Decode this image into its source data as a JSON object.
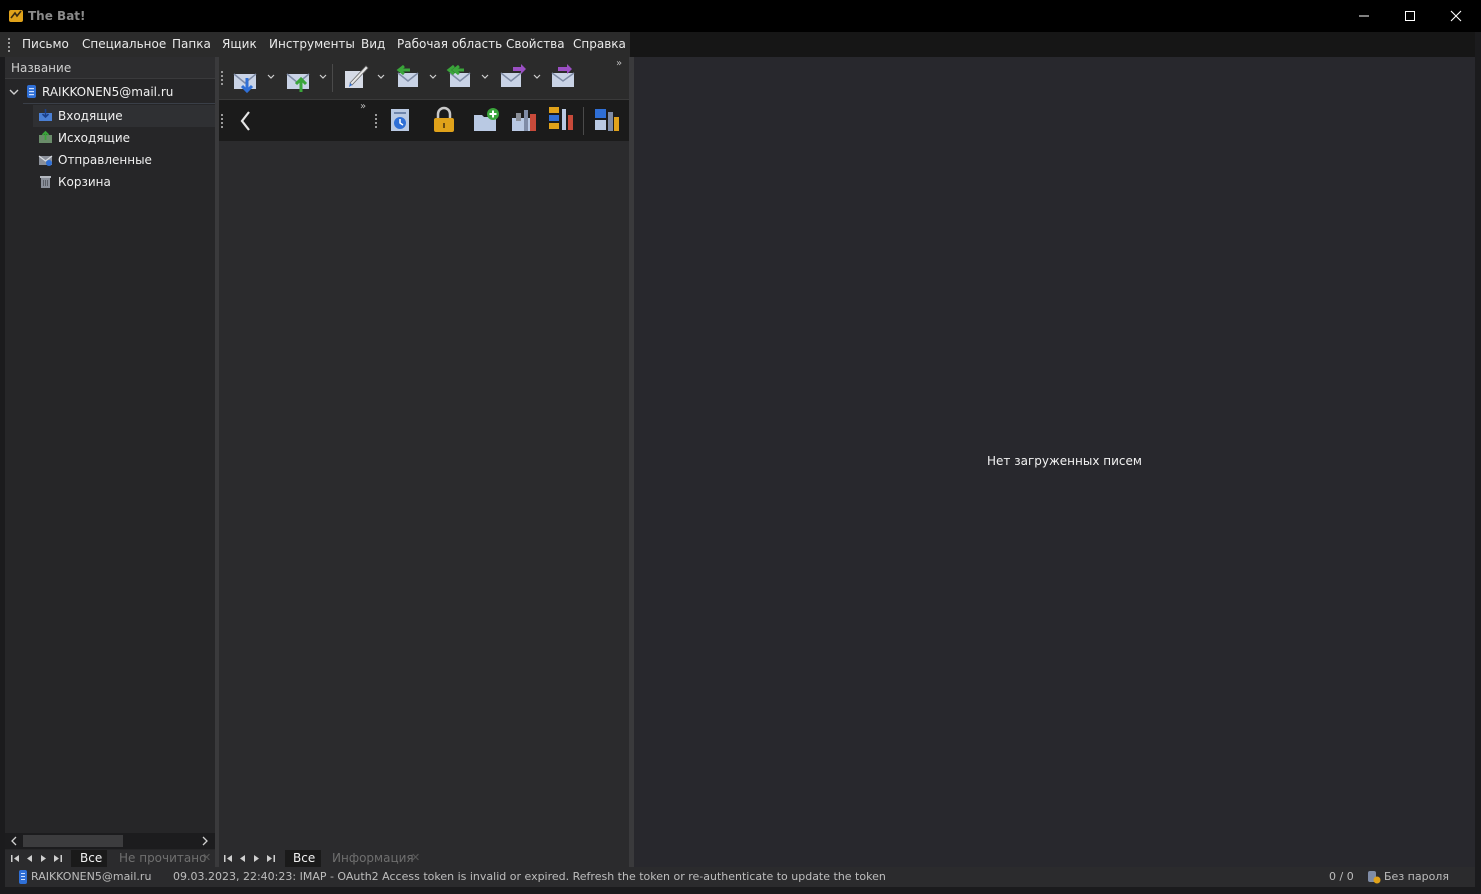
{
  "window": {
    "title": "The Bat!"
  },
  "menu": {
    "items": [
      "Письмо",
      "Специальное",
      "Папка",
      "Ящик",
      "Инструменты",
      "Вид",
      "Рабочая область",
      "Свойства",
      "Справка"
    ]
  },
  "folders": {
    "header": "Название",
    "account": "RAIKKONEN5@mail.ru",
    "items": [
      "Входящие",
      "Исходящие",
      "Отправленные",
      "Корзина"
    ],
    "tabs": {
      "all": "Все",
      "unread": "Не прочитано"
    }
  },
  "toolbar": {
    "row1_icons": [
      "get-mail-icon",
      "send-mail-icon",
      "new-message-icon",
      "reply-icon",
      "reply-all-icon",
      "forward-icon",
      "redirect-icon"
    ],
    "row2_icons": [
      "back-icon",
      "address-book-icon",
      "lock-icon",
      "new-folder-icon",
      "tools-icon",
      "sorting-office-icon",
      "workspace-icon"
    ]
  },
  "messages": {
    "tabs": {
      "all": "Все",
      "info": "Информация"
    }
  },
  "viewer": {
    "empty_text": "Нет загруженных писем"
  },
  "status": {
    "account": "RAIKKONEN5@mail.ru",
    "log": "09.03.2023, 22:40:23: IMAP  - OAuth2 Access token is invalid or expired. Refresh the token or re-authenticate to update the token",
    "count": "0 / 0",
    "password": "Без пароля"
  },
  "colors": {
    "accent_blue": "#2f6fd6",
    "accent_green": "#3aa53a",
    "accent_purple": "#9b4fc4",
    "accent_gold": "#e0a21a"
  }
}
